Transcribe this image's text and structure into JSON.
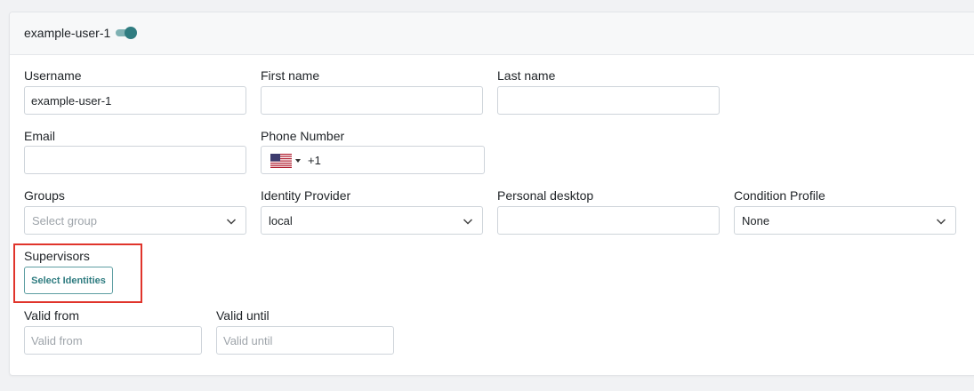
{
  "card": {
    "title": "example-user-1",
    "enabled": true
  },
  "fields": {
    "username": {
      "label": "Username",
      "value": "example-user-1"
    },
    "first_name": {
      "label": "First name",
      "value": ""
    },
    "last_name": {
      "label": "Last name",
      "value": ""
    },
    "email": {
      "label": "Email",
      "value": ""
    },
    "phone": {
      "label": "Phone Number",
      "dial_code": "+1",
      "country_icon": "us-flag-icon"
    },
    "groups": {
      "label": "Groups",
      "placeholder": "Select group"
    },
    "identity_provider": {
      "label": "Identity Provider",
      "value": "local"
    },
    "personal_desktop": {
      "label": "Personal desktop",
      "value": ""
    },
    "condition_profile": {
      "label": "Condition Profile",
      "value": "None"
    },
    "supervisors": {
      "label": "Supervisors",
      "button_label": "Select Identities"
    },
    "valid_from": {
      "label": "Valid from",
      "placeholder": "Valid from"
    },
    "valid_until": {
      "label": "Valid until",
      "placeholder": "Valid until"
    }
  },
  "colors": {
    "accent": "#2f7c80",
    "highlight": "#e0342b"
  }
}
